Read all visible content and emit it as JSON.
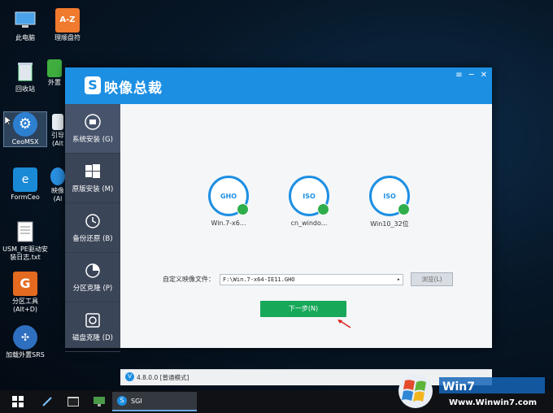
{
  "desktop": {
    "icons": [
      {
        "label": "此电脑",
        "icon": "computer-icon"
      },
      {
        "label": "理顺盘符",
        "icon": "az-icon"
      },
      {
        "label": "回收站",
        "icon": "recycle-bin-icon"
      },
      {
        "label": "外置",
        "icon": "green-app-icon"
      },
      {
        "label": "CeoMSX",
        "icon": "gear-icon"
      },
      {
        "label": "引导",
        "icon": "doc-icon"
      },
      {
        "label": "(Alt",
        "icon": ""
      },
      {
        "label": "FormCeo",
        "icon": "formceo-icon"
      },
      {
        "label": "映像",
        "icon": "image-icon"
      },
      {
        "label": "(Al",
        "icon": ""
      },
      {
        "label": "USM_PE驱动安装日志.txt",
        "icon": "text-file-icon"
      },
      {
        "label": "分区工具(Alt+D)",
        "icon": "partition-tool-icon"
      },
      {
        "label": "加载外置SRS",
        "icon": "srs-icon"
      }
    ]
  },
  "window": {
    "title": "映像总裁",
    "logo_letter": "S",
    "controls": {
      "menu": "≡",
      "minimize": "─",
      "close": "✕"
    },
    "sidebar": [
      {
        "label": "系统安装 (G)",
        "icon": "system-install-icon"
      },
      {
        "label": "原版安装 (M)",
        "icon": "windows-logo-icon"
      },
      {
        "label": "备份还原 (B)",
        "icon": "clock-restore-icon"
      },
      {
        "label": "分区克隆 (P)",
        "icon": "pie-partition-icon"
      },
      {
        "label": "磁盘克隆 (D)",
        "icon": "disk-clone-icon"
      }
    ],
    "images": [
      {
        "badge": "GHO",
        "label": "Win.7-x6..."
      },
      {
        "badge": "ISO",
        "label": "cn_windo..."
      },
      {
        "badge": "ISO",
        "label": "Win10_32位"
      }
    ],
    "custom_label": "自定义映像文件：",
    "custom_value": "F:\\Win.7-x64-IE11.GHO",
    "browse_label": "浏览(L)",
    "next_label": "下一步(N)",
    "version": "4.8.0.0 [普通模式]"
  },
  "taskbar": {
    "active_item": "SGI"
  },
  "brand": {
    "site": "Www.Winwin7.com"
  },
  "colors": {
    "accent": "#1d8fe3",
    "sidebar": "#3a4557",
    "next_button": "#17a85a"
  }
}
